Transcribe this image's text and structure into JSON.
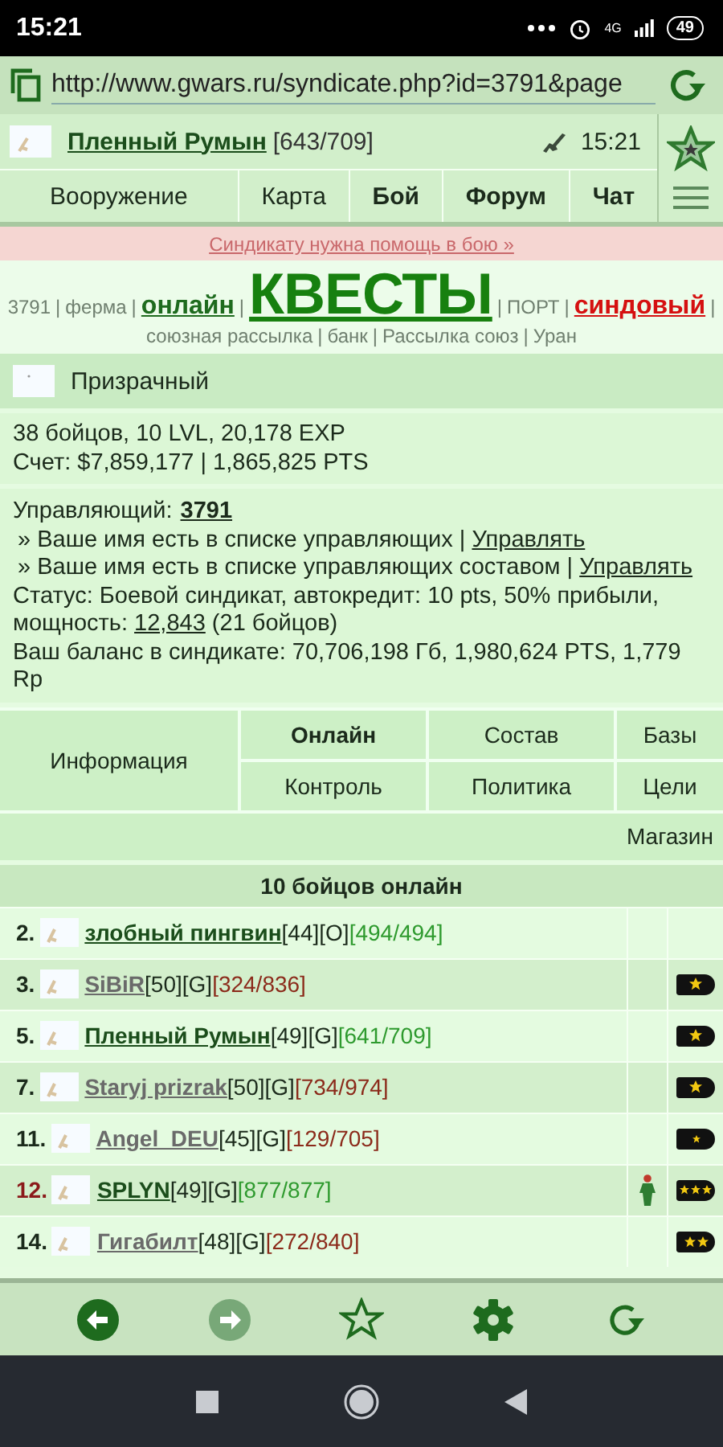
{
  "status_bar": {
    "time": "15:21",
    "network": "4G",
    "battery": "49"
  },
  "address_bar": {
    "url": "http://www.gwars.ru/syndicate.php?id=3791&page"
  },
  "header": {
    "player": "Пленный Румын",
    "hp": "[643/709]",
    "time": "15:21"
  },
  "nav_tabs": [
    {
      "label": "Вооружение",
      "bold": false
    },
    {
      "label": "Карта",
      "bold": false
    },
    {
      "label": "Бой",
      "bold": true
    },
    {
      "label": "Форум",
      "bold": true
    },
    {
      "label": "Чат",
      "bold": true
    }
  ],
  "alert": "Синдикату нужна помощь в бою »",
  "link_rows": [
    [
      {
        "kind": "plain",
        "text": "3791"
      },
      {
        "kind": "sep",
        "text": "|"
      },
      {
        "kind": "plain",
        "text": "ферма"
      },
      {
        "kind": "sep",
        "text": "|"
      },
      {
        "kind": "bold",
        "text": "онлайн"
      },
      {
        "kind": "sep",
        "text": "|"
      },
      {
        "kind": "big",
        "text": "КВЕСТЫ"
      },
      {
        "kind": "sep",
        "text": "|"
      },
      {
        "kind": "plain",
        "text": "ПОРТ"
      },
      {
        "kind": "sep",
        "text": "|"
      },
      {
        "kind": "red",
        "text": "синдовый"
      },
      {
        "kind": "sep",
        "text": "|"
      }
    ],
    [
      {
        "kind": "plain",
        "text": "союзная рассылка"
      },
      {
        "kind": "sep",
        "text": "|"
      },
      {
        "kind": "plain",
        "text": "банк"
      },
      {
        "kind": "sep",
        "text": "|"
      },
      {
        "kind": "plain",
        "text": "Рассылка союз"
      },
      {
        "kind": "sep",
        "text": "|"
      },
      {
        "kind": "plain",
        "text": "Уран"
      }
    ]
  ],
  "syndicate": {
    "name": "Призрачный"
  },
  "stats": [
    "38 бойцов, 10 LVL, 20,178 EXP",
    "Счет: $7,859,177 | 1,865,825 PTS"
  ],
  "management": {
    "label": "Управляющий:",
    "manager": "3791",
    "notes": [
      {
        "text": "» Ваше имя есть в списке управляющих |",
        "link": "Управлять"
      },
      {
        "text": "» Ваше имя есть в списке управляющих составом |",
        "link": "Управлять"
      }
    ],
    "status": {
      "before": "Статус: Боевой синдикат, автокредит: 10 pts, 50% прибыли, мощность:",
      "link": "12,843",
      "after": "(21 бойцов)"
    },
    "balance": "Ваш баланс в синдикате: 70,706,198 Гб, 1,980,624 PTS, 1,779 Rp"
  },
  "menu": [
    {
      "label": "Информация",
      "kind": "tall",
      "selected": false
    },
    {
      "label": "Онлайн",
      "kind": "cell",
      "selected": true
    },
    {
      "label": "Состав",
      "kind": "cell",
      "selected": false
    },
    {
      "label": "Базы",
      "kind": "cell",
      "selected": false
    },
    {
      "label": "Контроль",
      "kind": "cell",
      "selected": false
    },
    {
      "label": "Политика",
      "kind": "cell",
      "selected": false
    },
    {
      "label": "Цели",
      "kind": "cell",
      "selected": false
    },
    {
      "label": "Магазин",
      "kind": "wide",
      "selected": false
    }
  ],
  "online_title": "10 бойцов онлайн",
  "members": [
    {
      "rank": "2.",
      "rank_highlighted": false,
      "name": "злобный пингвин",
      "highlighted": true,
      "level": "[44]",
      "team": "[O]",
      "hp": "[494/494]",
      "hp_low": false,
      "figure": false,
      "kind": "none"
    },
    {
      "rank": "3.",
      "rank_highlighted": false,
      "name": "SiBiR",
      "highlighted": false,
      "level": "[50]",
      "team": "[G]",
      "hp": "[324/836]",
      "hp_low": true,
      "figure": false,
      "kind": "one"
    },
    {
      "rank": "5.",
      "rank_highlighted": false,
      "name": "Пленный Румын",
      "highlighted": true,
      "level": "[49]",
      "team": "[G]",
      "hp": "[641/709]",
      "hp_low": false,
      "figure": false,
      "kind": "one"
    },
    {
      "rank": "7.",
      "rank_highlighted": false,
      "name": "Staryj prizrak",
      "highlighted": false,
      "level": "[50]",
      "team": "[G]",
      "hp": "[734/974]",
      "hp_low": true,
      "figure": false,
      "kind": "one"
    },
    {
      "rank": "11.",
      "rank_highlighted": false,
      "name": "Angel_DEU",
      "highlighted": false,
      "level": "[45]",
      "team": "[G]",
      "hp": "[129/705]",
      "hp_low": true,
      "figure": false,
      "kind": "small"
    },
    {
      "rank": "12.",
      "rank_highlighted": true,
      "name": "SPLYN",
      "highlighted": true,
      "level": "[49]",
      "team": "[G]",
      "hp": "[877/877]",
      "hp_low": false,
      "figure": true,
      "kind": "three"
    },
    {
      "rank": "14.",
      "rank_highlighted": false,
      "name": "Гигабилт",
      "highlighted": false,
      "level": "[48]",
      "team": "[G]",
      "hp": "[272/840]",
      "hp_low": true,
      "figure": false,
      "kind": "two"
    }
  ]
}
